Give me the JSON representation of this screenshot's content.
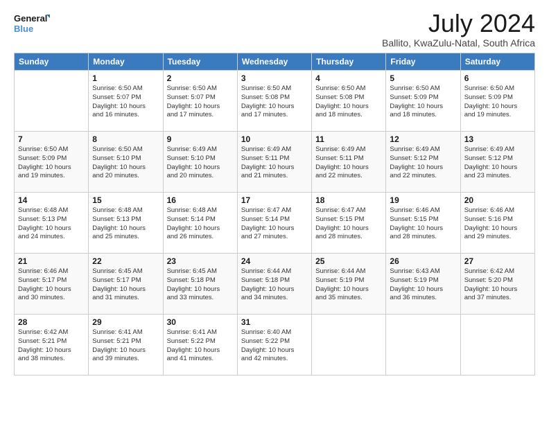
{
  "logo": {
    "line1": "General",
    "line2": "Blue"
  },
  "title": "July 2024",
  "subtitle": "Ballito, KwaZulu-Natal, South Africa",
  "days_of_week": [
    "Sunday",
    "Monday",
    "Tuesday",
    "Wednesday",
    "Thursday",
    "Friday",
    "Saturday"
  ],
  "weeks": [
    [
      {
        "num": "",
        "info": ""
      },
      {
        "num": "1",
        "info": "Sunrise: 6:50 AM\nSunset: 5:07 PM\nDaylight: 10 hours\nand 16 minutes."
      },
      {
        "num": "2",
        "info": "Sunrise: 6:50 AM\nSunset: 5:07 PM\nDaylight: 10 hours\nand 17 minutes."
      },
      {
        "num": "3",
        "info": "Sunrise: 6:50 AM\nSunset: 5:08 PM\nDaylight: 10 hours\nand 17 minutes."
      },
      {
        "num": "4",
        "info": "Sunrise: 6:50 AM\nSunset: 5:08 PM\nDaylight: 10 hours\nand 18 minutes."
      },
      {
        "num": "5",
        "info": "Sunrise: 6:50 AM\nSunset: 5:09 PM\nDaylight: 10 hours\nand 18 minutes."
      },
      {
        "num": "6",
        "info": "Sunrise: 6:50 AM\nSunset: 5:09 PM\nDaylight: 10 hours\nand 19 minutes."
      }
    ],
    [
      {
        "num": "7",
        "info": "Sunrise: 6:50 AM\nSunset: 5:09 PM\nDaylight: 10 hours\nand 19 minutes."
      },
      {
        "num": "8",
        "info": "Sunrise: 6:50 AM\nSunset: 5:10 PM\nDaylight: 10 hours\nand 20 minutes."
      },
      {
        "num": "9",
        "info": "Sunrise: 6:49 AM\nSunset: 5:10 PM\nDaylight: 10 hours\nand 20 minutes."
      },
      {
        "num": "10",
        "info": "Sunrise: 6:49 AM\nSunset: 5:11 PM\nDaylight: 10 hours\nand 21 minutes."
      },
      {
        "num": "11",
        "info": "Sunrise: 6:49 AM\nSunset: 5:11 PM\nDaylight: 10 hours\nand 22 minutes."
      },
      {
        "num": "12",
        "info": "Sunrise: 6:49 AM\nSunset: 5:12 PM\nDaylight: 10 hours\nand 22 minutes."
      },
      {
        "num": "13",
        "info": "Sunrise: 6:49 AM\nSunset: 5:12 PM\nDaylight: 10 hours\nand 23 minutes."
      }
    ],
    [
      {
        "num": "14",
        "info": "Sunrise: 6:48 AM\nSunset: 5:13 PM\nDaylight: 10 hours\nand 24 minutes."
      },
      {
        "num": "15",
        "info": "Sunrise: 6:48 AM\nSunset: 5:13 PM\nDaylight: 10 hours\nand 25 minutes."
      },
      {
        "num": "16",
        "info": "Sunrise: 6:48 AM\nSunset: 5:14 PM\nDaylight: 10 hours\nand 26 minutes."
      },
      {
        "num": "17",
        "info": "Sunrise: 6:47 AM\nSunset: 5:14 PM\nDaylight: 10 hours\nand 27 minutes."
      },
      {
        "num": "18",
        "info": "Sunrise: 6:47 AM\nSunset: 5:15 PM\nDaylight: 10 hours\nand 28 minutes."
      },
      {
        "num": "19",
        "info": "Sunrise: 6:46 AM\nSunset: 5:15 PM\nDaylight: 10 hours\nand 28 minutes."
      },
      {
        "num": "20",
        "info": "Sunrise: 6:46 AM\nSunset: 5:16 PM\nDaylight: 10 hours\nand 29 minutes."
      }
    ],
    [
      {
        "num": "21",
        "info": "Sunrise: 6:46 AM\nSunset: 5:17 PM\nDaylight: 10 hours\nand 30 minutes."
      },
      {
        "num": "22",
        "info": "Sunrise: 6:45 AM\nSunset: 5:17 PM\nDaylight: 10 hours\nand 31 minutes."
      },
      {
        "num": "23",
        "info": "Sunrise: 6:45 AM\nSunset: 5:18 PM\nDaylight: 10 hours\nand 33 minutes."
      },
      {
        "num": "24",
        "info": "Sunrise: 6:44 AM\nSunset: 5:18 PM\nDaylight: 10 hours\nand 34 minutes."
      },
      {
        "num": "25",
        "info": "Sunrise: 6:44 AM\nSunset: 5:19 PM\nDaylight: 10 hours\nand 35 minutes."
      },
      {
        "num": "26",
        "info": "Sunrise: 6:43 AM\nSunset: 5:19 PM\nDaylight: 10 hours\nand 36 minutes."
      },
      {
        "num": "27",
        "info": "Sunrise: 6:42 AM\nSunset: 5:20 PM\nDaylight: 10 hours\nand 37 minutes."
      }
    ],
    [
      {
        "num": "28",
        "info": "Sunrise: 6:42 AM\nSunset: 5:21 PM\nDaylight: 10 hours\nand 38 minutes."
      },
      {
        "num": "29",
        "info": "Sunrise: 6:41 AM\nSunset: 5:21 PM\nDaylight: 10 hours\nand 39 minutes."
      },
      {
        "num": "30",
        "info": "Sunrise: 6:41 AM\nSunset: 5:22 PM\nDaylight: 10 hours\nand 41 minutes."
      },
      {
        "num": "31",
        "info": "Sunrise: 6:40 AM\nSunset: 5:22 PM\nDaylight: 10 hours\nand 42 minutes."
      },
      {
        "num": "",
        "info": ""
      },
      {
        "num": "",
        "info": ""
      },
      {
        "num": "",
        "info": ""
      }
    ]
  ]
}
